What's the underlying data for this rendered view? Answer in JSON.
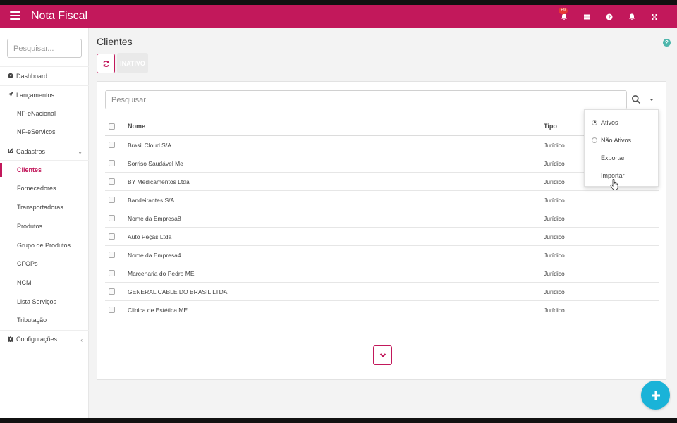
{
  "app": {
    "title": "Nota Fiscal",
    "notification_count": "+9"
  },
  "colors": {
    "brand": "#c2185b",
    "fab": "#1ab3d8",
    "help": "#4db6ac"
  },
  "topbar_icons": [
    "bell-icon",
    "list-icon",
    "help-icon",
    "bell-icon",
    "fullscreen-icon"
  ],
  "sidebar": {
    "search_placeholder": "Pesquisar...",
    "items": [
      {
        "label": "Dashboard",
        "icon": "dashboard-icon"
      },
      {
        "label": "Lançamentos",
        "icon": "paper-plane-icon"
      },
      {
        "label": "NF-eNacional"
      },
      {
        "label": "NF-eServicos"
      },
      {
        "label": "Cadastros",
        "icon": "edit-icon",
        "chevron": "⌄"
      },
      {
        "label": "Clientes",
        "active": true
      },
      {
        "label": "Fornecedores"
      },
      {
        "label": "Transportadoras"
      },
      {
        "label": "Produtos"
      },
      {
        "label": "Grupo de Produtos"
      },
      {
        "label": "CFOPs"
      },
      {
        "label": "NCM"
      },
      {
        "label": "Lista Serviços"
      },
      {
        "label": "Tributação"
      },
      {
        "label": "Configurações",
        "icon": "gear-icon",
        "chevron": "‹"
      }
    ]
  },
  "main": {
    "title": "Clientes",
    "inativo_label": "INATIVO",
    "search_placeholder": "Pesquisar",
    "columns": {
      "nome": "Nome",
      "tipo": "Tipo"
    },
    "rows": [
      {
        "nome": "Brasil Cloud S/A",
        "tipo": "Jurídico"
      },
      {
        "nome": "Sorriso Saudável Me",
        "tipo": "Jurídico"
      },
      {
        "nome": "BY Medicamentos Ltda",
        "tipo": "Jurídico"
      },
      {
        "nome": "Bandeirantes S/A",
        "tipo": "Jurídico"
      },
      {
        "nome": "Nome da Empresa8",
        "tipo": "Jurídico"
      },
      {
        "nome": "Auto Peças Ltda",
        "tipo": "Jurídico"
      },
      {
        "nome": "Nome da Empresa4",
        "tipo": "Jurídico"
      },
      {
        "nome": "Marcenaria do Pedro ME",
        "tipo": "Jurídico"
      },
      {
        "nome": "GENERAL CABLE DO BRASIL LTDA",
        "tipo": "Jurídico"
      },
      {
        "nome": "Clinica de Estética ME",
        "tipo": "Jurídico"
      }
    ]
  },
  "dropdown": {
    "items": [
      {
        "label": "Ativos",
        "radio": true,
        "selected": true
      },
      {
        "label": "Não Ativos",
        "radio": true,
        "selected": false
      },
      {
        "label": "Exportar"
      },
      {
        "label": "Importar"
      }
    ]
  }
}
